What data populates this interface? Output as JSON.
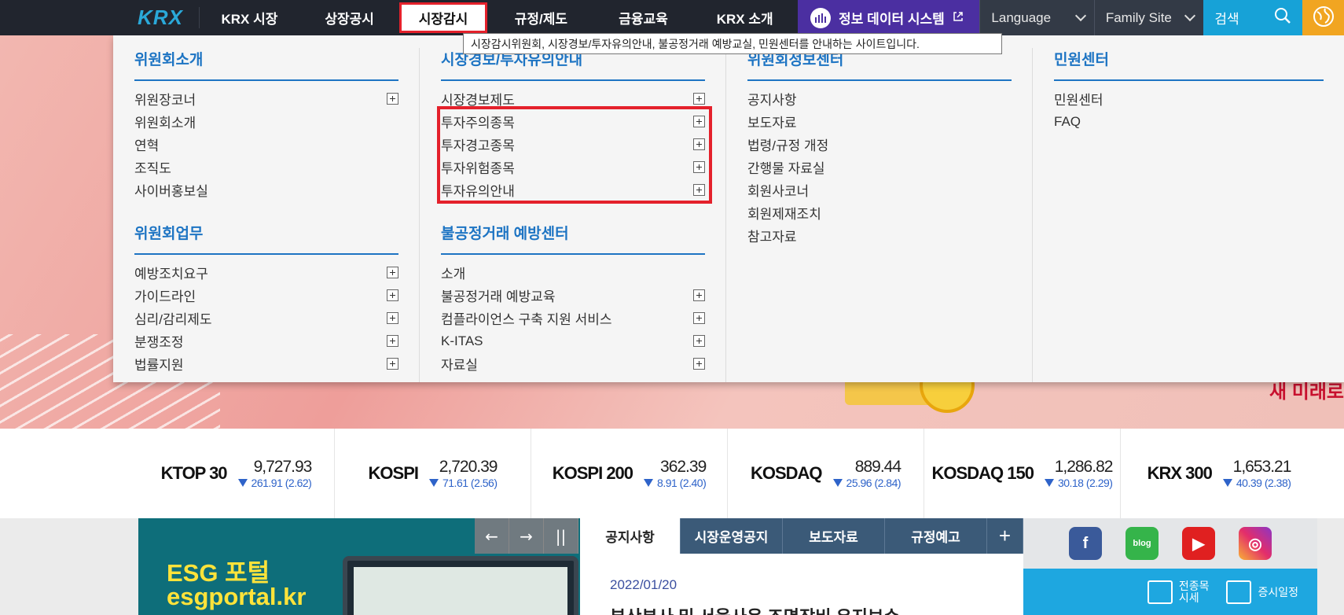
{
  "topnav": {
    "logo": "KRX",
    "items": [
      "KRX 시장",
      "상장공시",
      "시장감시",
      "규정/제도",
      "금융교육",
      "KRX 소개"
    ],
    "data_system": "정보 데이터 시스템",
    "language": "Language",
    "family_site": "Family Site",
    "search": "검색"
  },
  "tooltip": "시장감시위원회, 시장경보/투자유의안내, 불공정거래 예방교실, 민원센터를 안내하는 사이트입니다.",
  "megamenu": {
    "col1": {
      "title1": "위원회소개",
      "items1": [
        {
          "label": "위원장코너",
          "plus": true
        },
        {
          "label": "위원회소개",
          "plus": false
        },
        {
          "label": "연혁",
          "plus": false
        },
        {
          "label": "조직도",
          "plus": false
        },
        {
          "label": "사이버홍보실",
          "plus": false
        }
      ],
      "title2": "위원회업무",
      "items2": [
        {
          "label": "예방조치요구",
          "plus": true
        },
        {
          "label": "가이드라인",
          "plus": true
        },
        {
          "label": "심리/감리제도",
          "plus": true
        },
        {
          "label": "분쟁조정",
          "plus": true
        },
        {
          "label": "법률지원",
          "plus": true
        }
      ]
    },
    "col2": {
      "title1": "시장경보/투자유의안내",
      "items1": [
        {
          "label": "시장경보제도",
          "plus": true
        },
        {
          "label": "투자주의종목",
          "plus": true
        },
        {
          "label": "투자경고종목",
          "plus": true
        },
        {
          "label": "투자위험종목",
          "plus": true
        },
        {
          "label": "투자유의안내",
          "plus": true
        }
      ],
      "title2": "불공정거래 예방센터",
      "items2": [
        {
          "label": "소개",
          "plus": false
        },
        {
          "label": "불공정거래 예방교육",
          "plus": true
        },
        {
          "label": "컴플라이언스 구축 지원 서비스",
          "plus": true
        },
        {
          "label": "K-ITAS",
          "plus": true
        },
        {
          "label": "자료실",
          "plus": true
        }
      ]
    },
    "col3": {
      "title1": "위원회정보센터",
      "items1": [
        {
          "label": "공지사항",
          "plus": false
        },
        {
          "label": "보도자료",
          "plus": false
        },
        {
          "label": "법령/규정 개정",
          "plus": false
        },
        {
          "label": "간행물 자료실",
          "plus": false
        },
        {
          "label": "회원사코너",
          "plus": false
        },
        {
          "label": "회원제재조치",
          "plus": false
        },
        {
          "label": "참고자료",
          "plus": false
        }
      ]
    },
    "col4": {
      "title1": "민원센터",
      "items1": [
        {
          "label": "민원센터",
          "plus": false
        },
        {
          "label": "FAQ",
          "plus": false
        }
      ]
    }
  },
  "hero": {
    "slogan": "새 미래로"
  },
  "ticker": [
    {
      "name": "KTOP 30",
      "price": "9,727.93",
      "change": "261.91 (2.62)"
    },
    {
      "name": "KOSPI",
      "price": "2,720.39",
      "change": "71.61 (2.56)"
    },
    {
      "name": "KOSPI 200",
      "price": "362.39",
      "change": "8.91 (2.40)"
    },
    {
      "name": "KOSDAQ",
      "price": "889.44",
      "change": "25.96 (2.84)"
    },
    {
      "name": "KOSDAQ 150",
      "price": "1,286.82",
      "change": "30.18 (2.29)"
    },
    {
      "name": "KRX 300",
      "price": "1,653.21",
      "change": "40.39 (2.38)"
    }
  ],
  "banner": {
    "line1": "ESG 포털",
    "line2": "esgportal.kr"
  },
  "banner_controls": {
    "prev": "←",
    "next": "→",
    "pause": "||"
  },
  "news": {
    "tabs": [
      "공지사항",
      "시장운영공지",
      "보도자료",
      "규정예고",
      "+"
    ],
    "date": "2022/01/20",
    "headline": "부산본사 및 서울사옥 조명장비 유지보수"
  },
  "social": {
    "facebook": "f",
    "blog": "blog",
    "youtube": "▶",
    "instagram": "◎"
  },
  "quick": {
    "all_stocks": "전종목\n시세",
    "schedule": "증시일정"
  }
}
